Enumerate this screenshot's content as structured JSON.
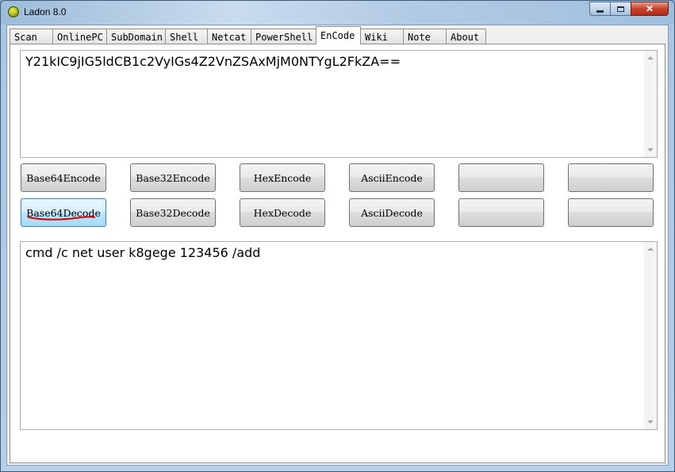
{
  "window": {
    "title": "Ladon 8.0",
    "controls": {
      "minimize": "▬",
      "maximize": "▢",
      "close": "✕"
    }
  },
  "tabs": [
    {
      "label": "Scan"
    },
    {
      "label": "OnlinePC"
    },
    {
      "label": "SubDomain"
    },
    {
      "label": "Shell"
    },
    {
      "label": "Netcat"
    },
    {
      "label": "PowerShell"
    },
    {
      "label": "EnCode"
    },
    {
      "label": "Wiki"
    },
    {
      "label": "Note"
    },
    {
      "label": "About"
    }
  ],
  "active_tab": "EnCode",
  "input_text": "Y21kIC9jIG5ldCB1c2VyIGs4Z2VnZSAxMjM0NTYgL2FkZA==",
  "output_text": "cmd /c net user k8gege 123456 /add",
  "buttons_row1": [
    "Base64Encode",
    "Base32Encode",
    "HexEncode",
    "AsciiEncode",
    "",
    ""
  ],
  "buttons_row2": [
    "Base64Decode",
    "Base32Decode",
    "HexDecode",
    "AsciiDecode",
    "",
    ""
  ],
  "focused_button": "Base64Decode",
  "colors": {
    "annotation_underline": "#d40000",
    "focus_border": "#3c7fb1"
  },
  "icons": {
    "app_logo": "ladon-logo-icon"
  }
}
